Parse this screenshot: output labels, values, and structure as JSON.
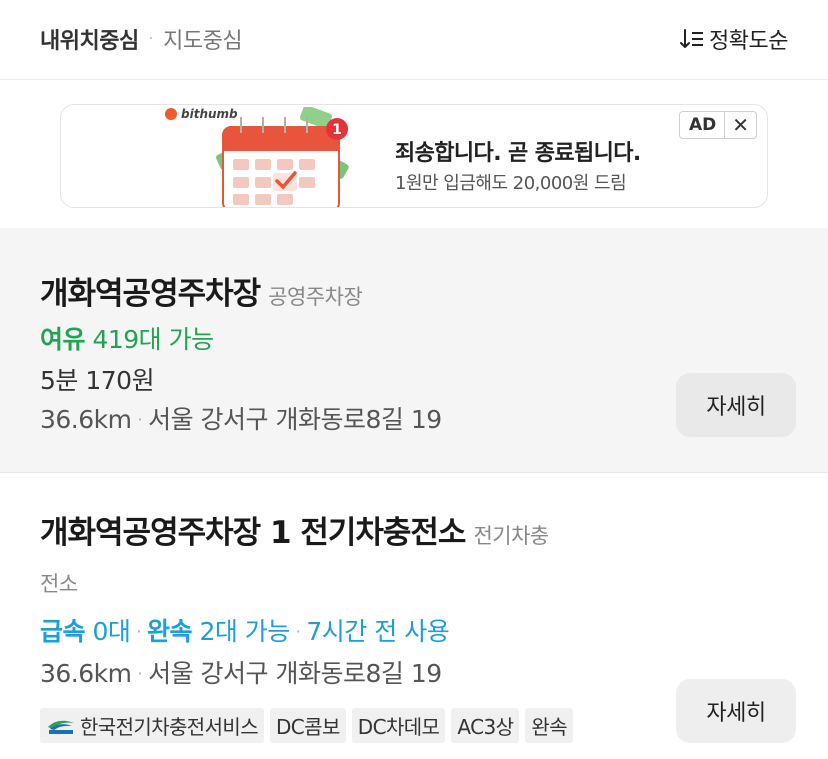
{
  "header": {
    "tab_my_location": "내위치중심",
    "separator": "·",
    "tab_map_center": "지도중심",
    "sort_label": "정확도순"
  },
  "ad": {
    "brand": "bithumb",
    "notification_count": "1",
    "title": "죄송합니다. 곧 종료됩니다.",
    "subtitle": "1원만 입금해도 20,000원 드림",
    "badge": "AD",
    "close": "✕"
  },
  "results": [
    {
      "name": "개화역공영주차장",
      "category": "공영주차장",
      "availability_status": "여유",
      "availability_detail": "419대 가능",
      "fee": "5분 170원",
      "distance": "36.6km",
      "address": "서울 강서구 개화동로8길 19",
      "detail_button": "자세히"
    },
    {
      "name": "개화역공영주차장 1 전기차충전소",
      "category_line1": "전기차충",
      "category_line2": "전소",
      "fast_label": "급속",
      "fast_count": "0대",
      "slow_label": "완속",
      "slow_count": "2대 가능",
      "last_used": "7시간 전 사용",
      "distance": "36.6km",
      "address": "서울 강서구 개화동로8길 19",
      "tags": [
        "한국전기차충전서비스",
        "DC콤보",
        "DC차데모",
        "AC3상",
        "완속"
      ],
      "provider_logo": "kevcs-logo",
      "detail_button": "자세히"
    }
  ],
  "colors": {
    "available_green": "#21a354",
    "charger_blue": "#1b9ed9",
    "selected_card_bg": "#f5f5f5"
  }
}
